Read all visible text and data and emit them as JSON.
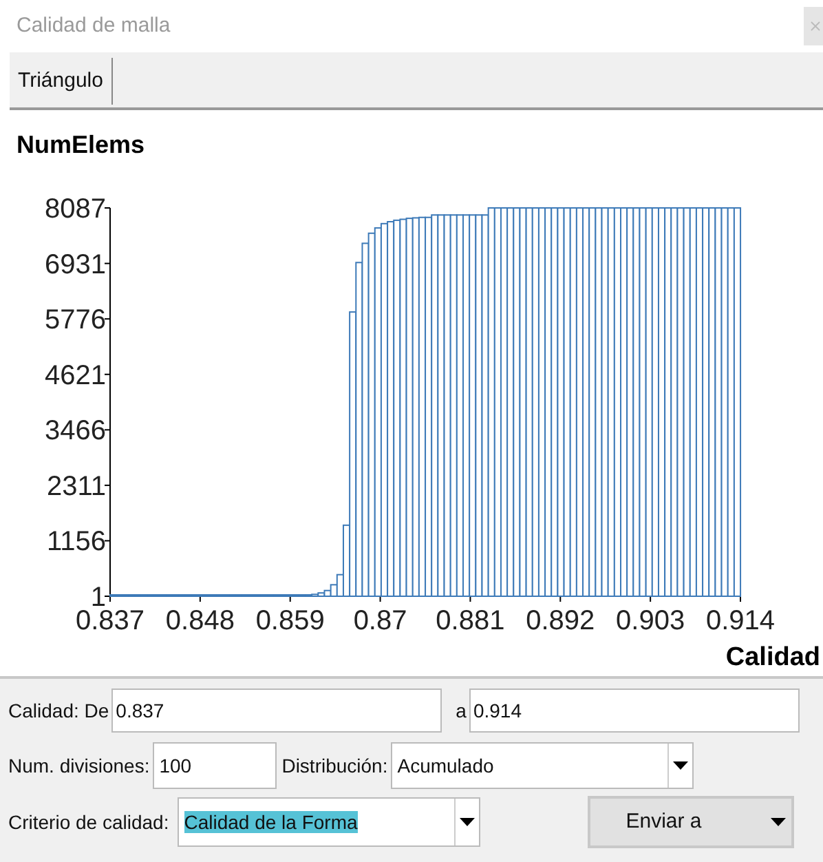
{
  "window": {
    "title": "Calidad de malla"
  },
  "tabs": [
    {
      "label": "Triángulo",
      "selected": true
    }
  ],
  "chart_data": {
    "type": "bar",
    "ylabel": "NumElems",
    "xlabel": "Calidad",
    "xlim": [
      0.837,
      0.914
    ],
    "ylim": [
      1,
      8087
    ],
    "xticks": [
      0.837,
      0.848,
      0.859,
      0.87,
      0.881,
      0.892,
      0.903,
      0.914
    ],
    "yticks": [
      1,
      1156,
      2311,
      3466,
      4621,
      5776,
      6931,
      8087
    ],
    "x": [
      0.83739,
      0.83816,
      0.83893,
      0.8397,
      0.84047,
      0.84124,
      0.84201,
      0.84278,
      0.84355,
      0.84432,
      0.84509,
      0.84586,
      0.84663,
      0.8474,
      0.84817,
      0.84894,
      0.84971,
      0.85048,
      0.85125,
      0.85202,
      0.85279,
      0.85356,
      0.85433,
      0.8551,
      0.85587,
      0.85664,
      0.85741,
      0.85818,
      0.85895,
      0.85972,
      0.86049,
      0.86126,
      0.86203,
      0.8628,
      0.86357,
      0.86434,
      0.86511,
      0.86588,
      0.86665,
      0.86742,
      0.86819,
      0.86896,
      0.86973,
      0.8705,
      0.87127,
      0.87204,
      0.87281,
      0.87358,
      0.87435,
      0.87512,
      0.87589,
      0.87666,
      0.87743,
      0.8782,
      0.87897,
      0.87974,
      0.88051,
      0.88128,
      0.88205,
      0.88282,
      0.88359,
      0.88436,
      0.88513,
      0.8859,
      0.88667,
      0.88744,
      0.88821,
      0.88898,
      0.88975,
      0.89052,
      0.89129,
      0.89206,
      0.89283,
      0.8936,
      0.89437,
      0.89514,
      0.89591,
      0.89668,
      0.89745,
      0.89822,
      0.89899,
      0.89976,
      0.90053,
      0.9013,
      0.90207,
      0.90284,
      0.90361,
      0.90438,
      0.90515,
      0.90592,
      0.90669,
      0.90746,
      0.90823,
      0.909,
      0.90977,
      0.91054,
      0.91131,
      0.91208,
      0.91285,
      0.91362
    ],
    "series": [
      {
        "color": "#3d7ab8",
        "values": [
          1,
          1,
          1,
          1,
          1,
          1,
          1,
          1,
          1,
          1,
          1,
          1,
          1,
          1,
          1,
          1,
          1,
          1,
          1,
          1,
          1,
          1,
          1,
          1,
          1,
          1,
          1,
          15,
          15,
          20,
          20,
          30,
          40,
          70,
          120,
          240,
          450,
          1480,
          5920,
          6950,
          7350,
          7560,
          7670,
          7760,
          7800,
          7830,
          7850,
          7870,
          7880,
          7890,
          7890,
          7940,
          7940,
          7940,
          7940,
          7940,
          7940,
          7940,
          7940,
          7940,
          8087,
          8087,
          8087,
          8087,
          8087,
          8087,
          8087,
          8087,
          8087,
          8087,
          8087,
          8087,
          8087,
          8087,
          8087,
          8087,
          8087,
          8087,
          8087,
          8087,
          8087,
          8087,
          8087,
          8087,
          8087,
          8087,
          8087,
          8087,
          8087,
          8087,
          8087,
          8087,
          8087,
          8087,
          8087,
          8087,
          8087,
          8087,
          8087,
          8087
        ]
      }
    ]
  },
  "form": {
    "range": {
      "label": "Calidad: De",
      "from": "0.837",
      "to_label": "a",
      "to": "0.914"
    },
    "divisions": {
      "label": "Num. divisiones:",
      "value": "100"
    },
    "distribution": {
      "label": "Distribución:",
      "value": "Acumulado"
    },
    "criterion": {
      "label": "Criterio de calidad:",
      "value": "Calidad de la Forma",
      "text_selected": true
    },
    "send_button": {
      "label": "Enviar a"
    }
  }
}
